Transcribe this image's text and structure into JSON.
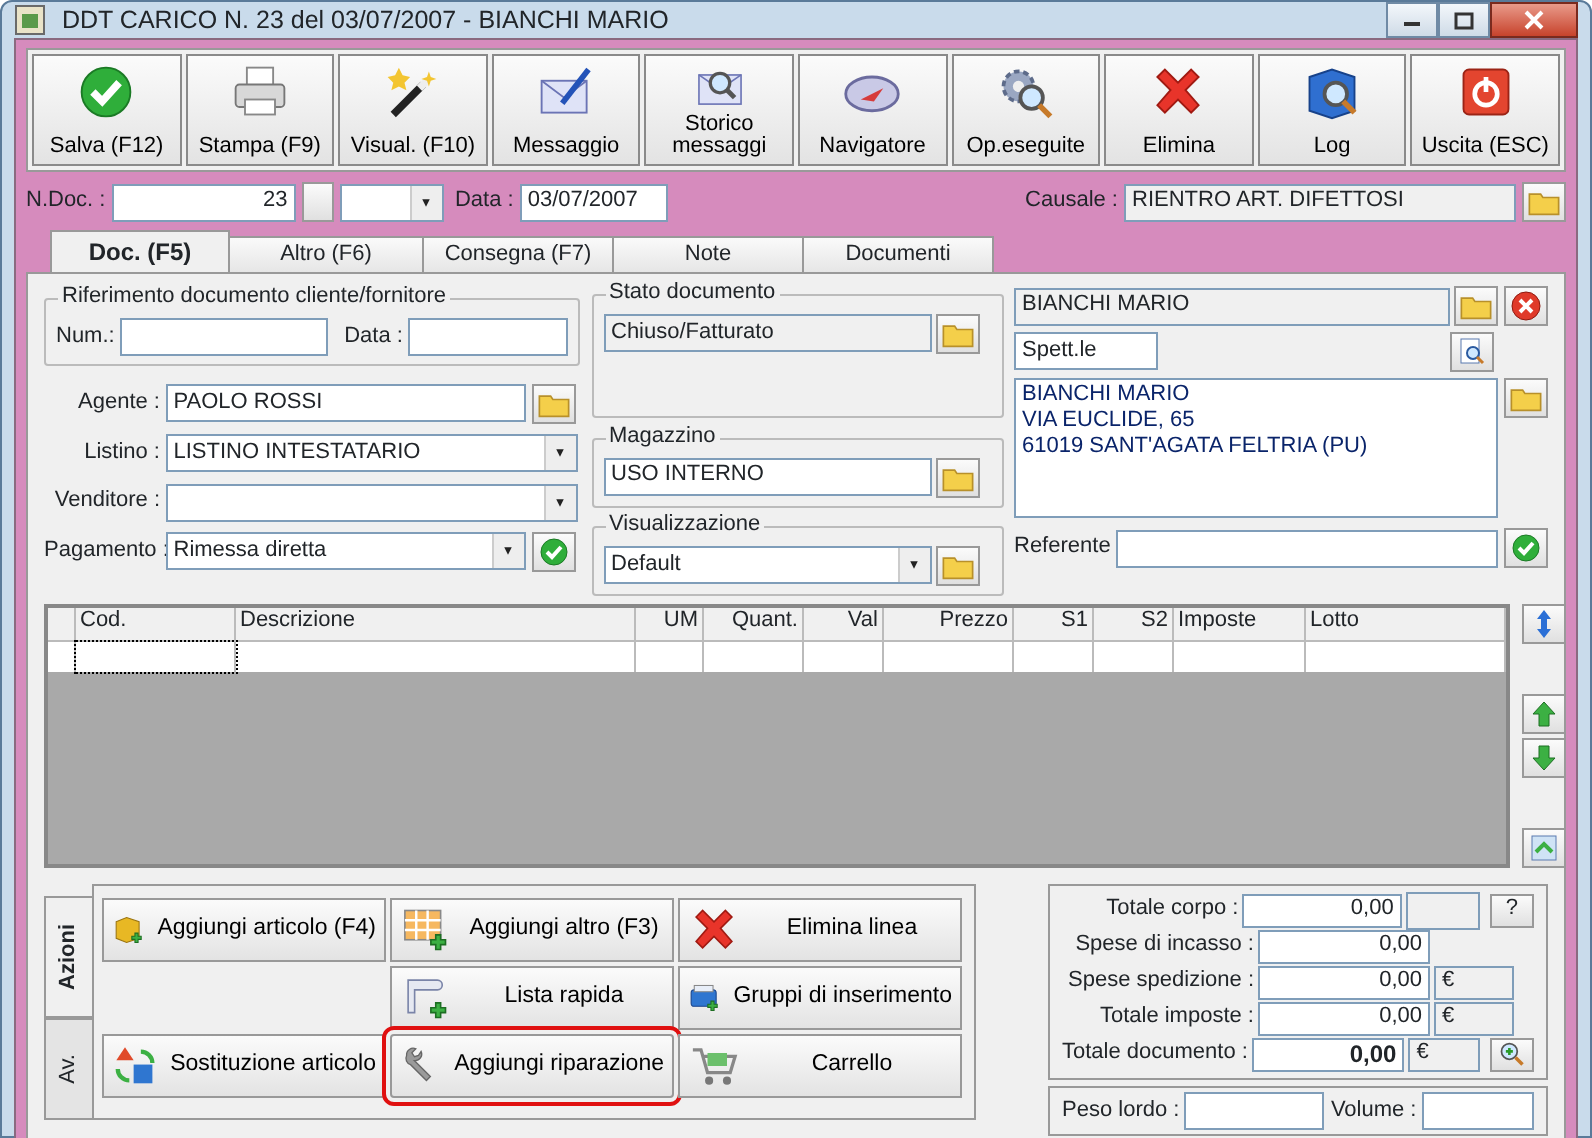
{
  "window": {
    "title": "DDT CARICO N. 23  del 03/07/2007 - BIANCHI MARIO"
  },
  "toolbar": [
    {
      "label": "Salva (F12)"
    },
    {
      "label": "Stampa (F9)"
    },
    {
      "label": "Visual. (F10)"
    },
    {
      "label": "Messaggio"
    },
    {
      "label": "Storico messaggi"
    },
    {
      "label": "Navigatore"
    },
    {
      "label": "Op.eseguite"
    },
    {
      "label": "Elimina"
    },
    {
      "label": "Log"
    },
    {
      "label": "Uscita (ESC)"
    }
  ],
  "header": {
    "ndoc_label": "N.Doc. :",
    "ndoc_value": "23",
    "data_label": "Data :",
    "data_value": "03/07/2007",
    "causale_label": "Causale :",
    "causale_value": "RIENTRO ART. DIFETTOSI"
  },
  "tabs": [
    {
      "label": "Doc. (F5)",
      "selected": true
    },
    {
      "label": "Altro (F6)",
      "selected": false
    },
    {
      "label": "Consegna (F7)",
      "selected": false
    },
    {
      "label": "Note",
      "selected": false
    },
    {
      "label": "Documenti",
      "selected": false
    }
  ],
  "reference": {
    "title": "Riferimento documento cliente/fornitore",
    "num_label": "Num.:",
    "data_label": "Data :"
  },
  "fields": [
    {
      "label": "Agente :",
      "value": "PAOLO ROSSI",
      "kind": "lookup"
    },
    {
      "label": "Listino :",
      "value": "LISTINO INTESTATARIO",
      "kind": "combo"
    },
    {
      "label": "Venditore :",
      "kind": "combo"
    },
    {
      "label": "Pagamento :",
      "value": "Rimessa diretta",
      "kind": "combo-confirm"
    }
  ],
  "groups": [
    {
      "title": "Stato documento",
      "value": "Chiuso/Fatturato",
      "kind": "readonly"
    },
    {
      "title": "Magazzino",
      "value": "USO INTERNO",
      "kind": "text"
    },
    {
      "title": "Visualizzazione",
      "value": "Default",
      "kind": "combo"
    }
  ],
  "customer": {
    "name": "BIANCHI MARIO",
    "salutation": "Spett.le",
    "address": [
      "BIANCHI MARIO",
      "VIA EUCLIDE, 65",
      "61019 SANT'AGATA FELTRIA (PU)"
    ],
    "referente_label": "Referente"
  },
  "table": {
    "columns": [
      {
        "label": "Cod."
      },
      {
        "label": "Descrizione"
      },
      {
        "label": "UM"
      },
      {
        "label": "Quant."
      },
      {
        "label": "Val"
      },
      {
        "label": "Prezzo"
      },
      {
        "label": "S1"
      },
      {
        "label": "S2"
      },
      {
        "label": "Imposte"
      },
      {
        "label": "Lotto"
      }
    ]
  },
  "action_tabs": [
    {
      "label": "Azioni",
      "selected": true
    },
    {
      "label": "Av.",
      "selected": false
    }
  ],
  "actions": [
    {
      "label": "Aggiungi articolo (F4)",
      "highlighted": false
    },
    {
      "label": "Aggiungi altro (F3)",
      "highlighted": false
    },
    {
      "label": "Elimina linea",
      "highlighted": false
    },
    {
      "label": "Lista rapida",
      "highlighted": false
    },
    {
      "label": "Gruppi di inserimento",
      "highlighted": false
    },
    {
      "label": "Sostituzione articolo",
      "highlighted": false
    },
    {
      "label": "Aggiungi riparazione",
      "highlighted": true
    },
    {
      "label": "Carrello",
      "highlighted": false
    }
  ],
  "totals": [
    {
      "label": "Totale corpo :",
      "value": "0,00",
      "kind": "extra",
      "bold": false
    },
    {
      "label": "Spese di incasso :",
      "value": "0,00",
      "kind": "plain",
      "bold": false
    },
    {
      "label": "Spese spedizione :",
      "value": "0,00",
      "kind": "currency",
      "unit": "€",
      "bold": false
    },
    {
      "label": "Totale imposte :",
      "value": "0,00",
      "kind": "currency",
      "unit": "€",
      "bold": false
    },
    {
      "label": "Totale documento :",
      "value": "0,00",
      "kind": "currency-zoom",
      "unit": "€",
      "bold": true
    }
  ],
  "help_button": "?",
  "footer": {
    "peso_label": "Peso lordo :",
    "volume_label": "Volume :"
  }
}
